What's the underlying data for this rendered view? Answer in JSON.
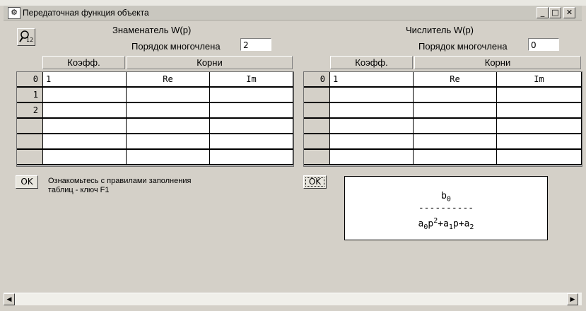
{
  "window": {
    "title": "Передаточная функция объекта",
    "minimize": "_",
    "maximize": "□",
    "close": "✕"
  },
  "zoom_button": {
    "icon": "magnifier-icon",
    "label": "12"
  },
  "denominator": {
    "title": "Знаменатель W(p)",
    "order_label": "Порядок многочлена",
    "order_value": "2",
    "col_coef": "Коэфф.",
    "col_roots": "Корни",
    "rows": [
      {
        "idx": "0",
        "coef": "1",
        "re": "Re",
        "im": "Im"
      },
      {
        "idx": "1",
        "coef": "",
        "re": "",
        "im": ""
      },
      {
        "idx": "2",
        "coef": "",
        "re": "",
        "im": ""
      },
      {
        "idx": "",
        "coef": "",
        "re": "",
        "im": ""
      },
      {
        "idx": "",
        "coef": "",
        "re": "",
        "im": ""
      },
      {
        "idx": "",
        "coef": "",
        "re": "",
        "im": ""
      }
    ]
  },
  "numerator": {
    "title": "Числитель W(p)",
    "order_label": "Порядок многочлена",
    "order_value": "0",
    "col_coef": "Коэфф.",
    "col_roots": "Корни",
    "rows": [
      {
        "idx": "0",
        "coef": "1",
        "re": "Re",
        "im": "Im"
      },
      {
        "idx": "",
        "coef": "",
        "re": "",
        "im": ""
      },
      {
        "idx": "",
        "coef": "",
        "re": "",
        "im": ""
      },
      {
        "idx": "",
        "coef": "",
        "re": "",
        "im": ""
      },
      {
        "idx": "",
        "coef": "",
        "re": "",
        "im": ""
      },
      {
        "idx": "",
        "coef": "",
        "re": "",
        "im": ""
      }
    ]
  },
  "ok_left": "OK",
  "ok_right": "OK",
  "note": "Ознакомьтесь с правилами заполнения таблиц - ключ F1",
  "formula": {
    "numerator": "b",
    "numerator_sub": "0",
    "bar": "----------",
    "den_a0": "a",
    "den_a0_sub": "0",
    "den_p": "p",
    "den_p_sup": "2",
    "den_plus1": "+a",
    "den_a1_sub": "1",
    "den_p2": "p+a",
    "den_a2_sub": "2"
  },
  "scrollbar": {
    "left": "◀",
    "right": "▶"
  }
}
